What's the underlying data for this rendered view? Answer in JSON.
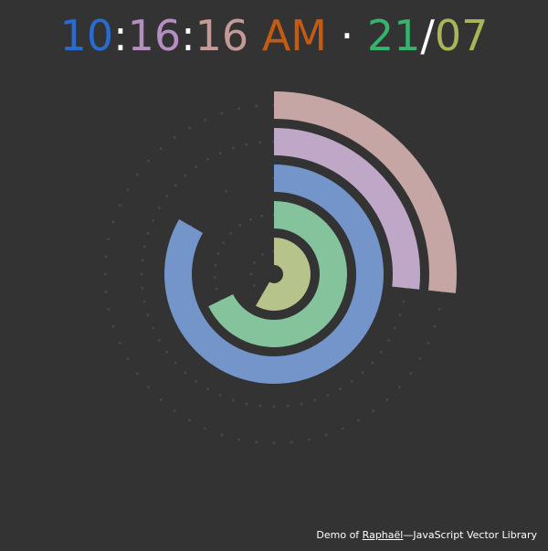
{
  "clock": {
    "hours": "10",
    "minutes": "16",
    "seconds": "16",
    "ampm": "AM",
    "dot": "·",
    "day": "21",
    "slash": "/",
    "month": "07",
    "colon": ":"
  },
  "colors": {
    "hours": "#2a6bcf",
    "minutes": "#b58fc2",
    "seconds": "#c49a98",
    "ampm": "#c35c12",
    "day": "#36b46c",
    "month": "#a9b556",
    "background": "#333333",
    "arc_seconds": "#c6a6a4",
    "arc_minutes": "#bfa7c8",
    "arc_hours": "#7395c9",
    "arc_day": "#84c39b",
    "arc_month": "#b6c38b",
    "tick": "#484848"
  },
  "rings": [
    {
      "name": "seconds",
      "value": 16,
      "max": 60,
      "color_key": "arc_seconds"
    },
    {
      "name": "minutes",
      "value": 16,
      "max": 60,
      "color_key": "arc_minutes"
    },
    {
      "name": "hours",
      "value": 10,
      "max": 12,
      "color_key": "arc_hours"
    },
    {
      "name": "day",
      "value": 21,
      "max": 31,
      "color_key": "arc_day"
    },
    {
      "name": "month",
      "value": 7,
      "max": 12,
      "color_key": "arc_month"
    }
  ],
  "footer": {
    "prefix": "Demo of ",
    "link": "Raphaël",
    "suffix": "—JavaScript Vector Library"
  }
}
